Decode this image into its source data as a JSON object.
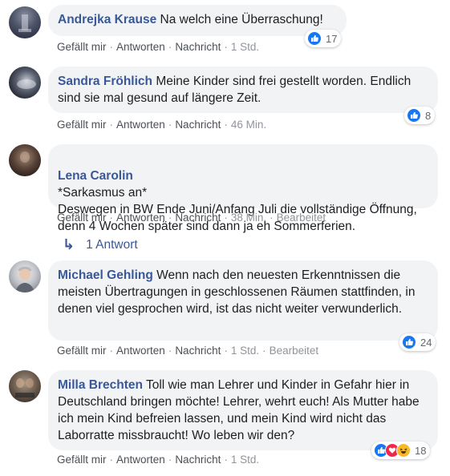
{
  "actions": {
    "like": "Gefällt mir",
    "reply": "Antworten",
    "message": "Nachricht",
    "separator": "·"
  },
  "comments": [
    {
      "author": "Andrejka Krause",
      "text": "Na welch eine Überraschung!",
      "time": "1 Std.",
      "edited": "",
      "reactions": [
        "like-icon"
      ],
      "reaction_count": "17"
    },
    {
      "author": "Sandra Fröhlich",
      "text": "Meine Kinder sind frei gestellt worden. Endlich sind sie mal gesund auf längere Zeit.",
      "time": "46 Min.",
      "edited": "",
      "reactions": [
        "like-icon"
      ],
      "reaction_count": "8"
    },
    {
      "author": "Lena Carolin",
      "text": "*Sarkasmus an*\nDeswegen in BW Ende Juni/Anfang Juli die vollständige Öffnung, denn 4 Wochen später sind dann ja eh Sommerferien.",
      "time": "38 Min.",
      "edited": "Bearbeitet",
      "reactions": [],
      "reaction_count": ""
    },
    {
      "author": "Michael Gehling",
      "text": "Wenn nach den neuesten Erkenntnissen die meisten Übertragungen in geschlossenen Räumen stattfinden, in denen viel gesprochen wird, ist das nicht weiter verwunderlich.",
      "time": "1 Std.",
      "edited": "Bearbeitet",
      "reactions": [
        "like-icon"
      ],
      "reaction_count": "24"
    },
    {
      "author": "Milla Brechten",
      "text": "Toll wie man Lehrer und Kinder in Gefahr hier in Deutschland bringen möchte! Lehrer, wehrt euch! Als Mutter habe ich mein Kind befreien lassen, und mein Kind wird nicht das Laborratte missbraucht! Wo leben wir den?",
      "time": "1 Std.",
      "edited": "",
      "reactions": [
        "like-icon",
        "love-icon",
        "haha-icon"
      ],
      "reaction_count": "18"
    }
  ],
  "replies_toggle": {
    "arrow": "↳",
    "label": "1 Antwort"
  },
  "colors": {
    "name": "#385898",
    "bubble": "#f2f3f5",
    "like": "#1877f2",
    "love": "#f0284a",
    "haha": "#f7b928"
  }
}
